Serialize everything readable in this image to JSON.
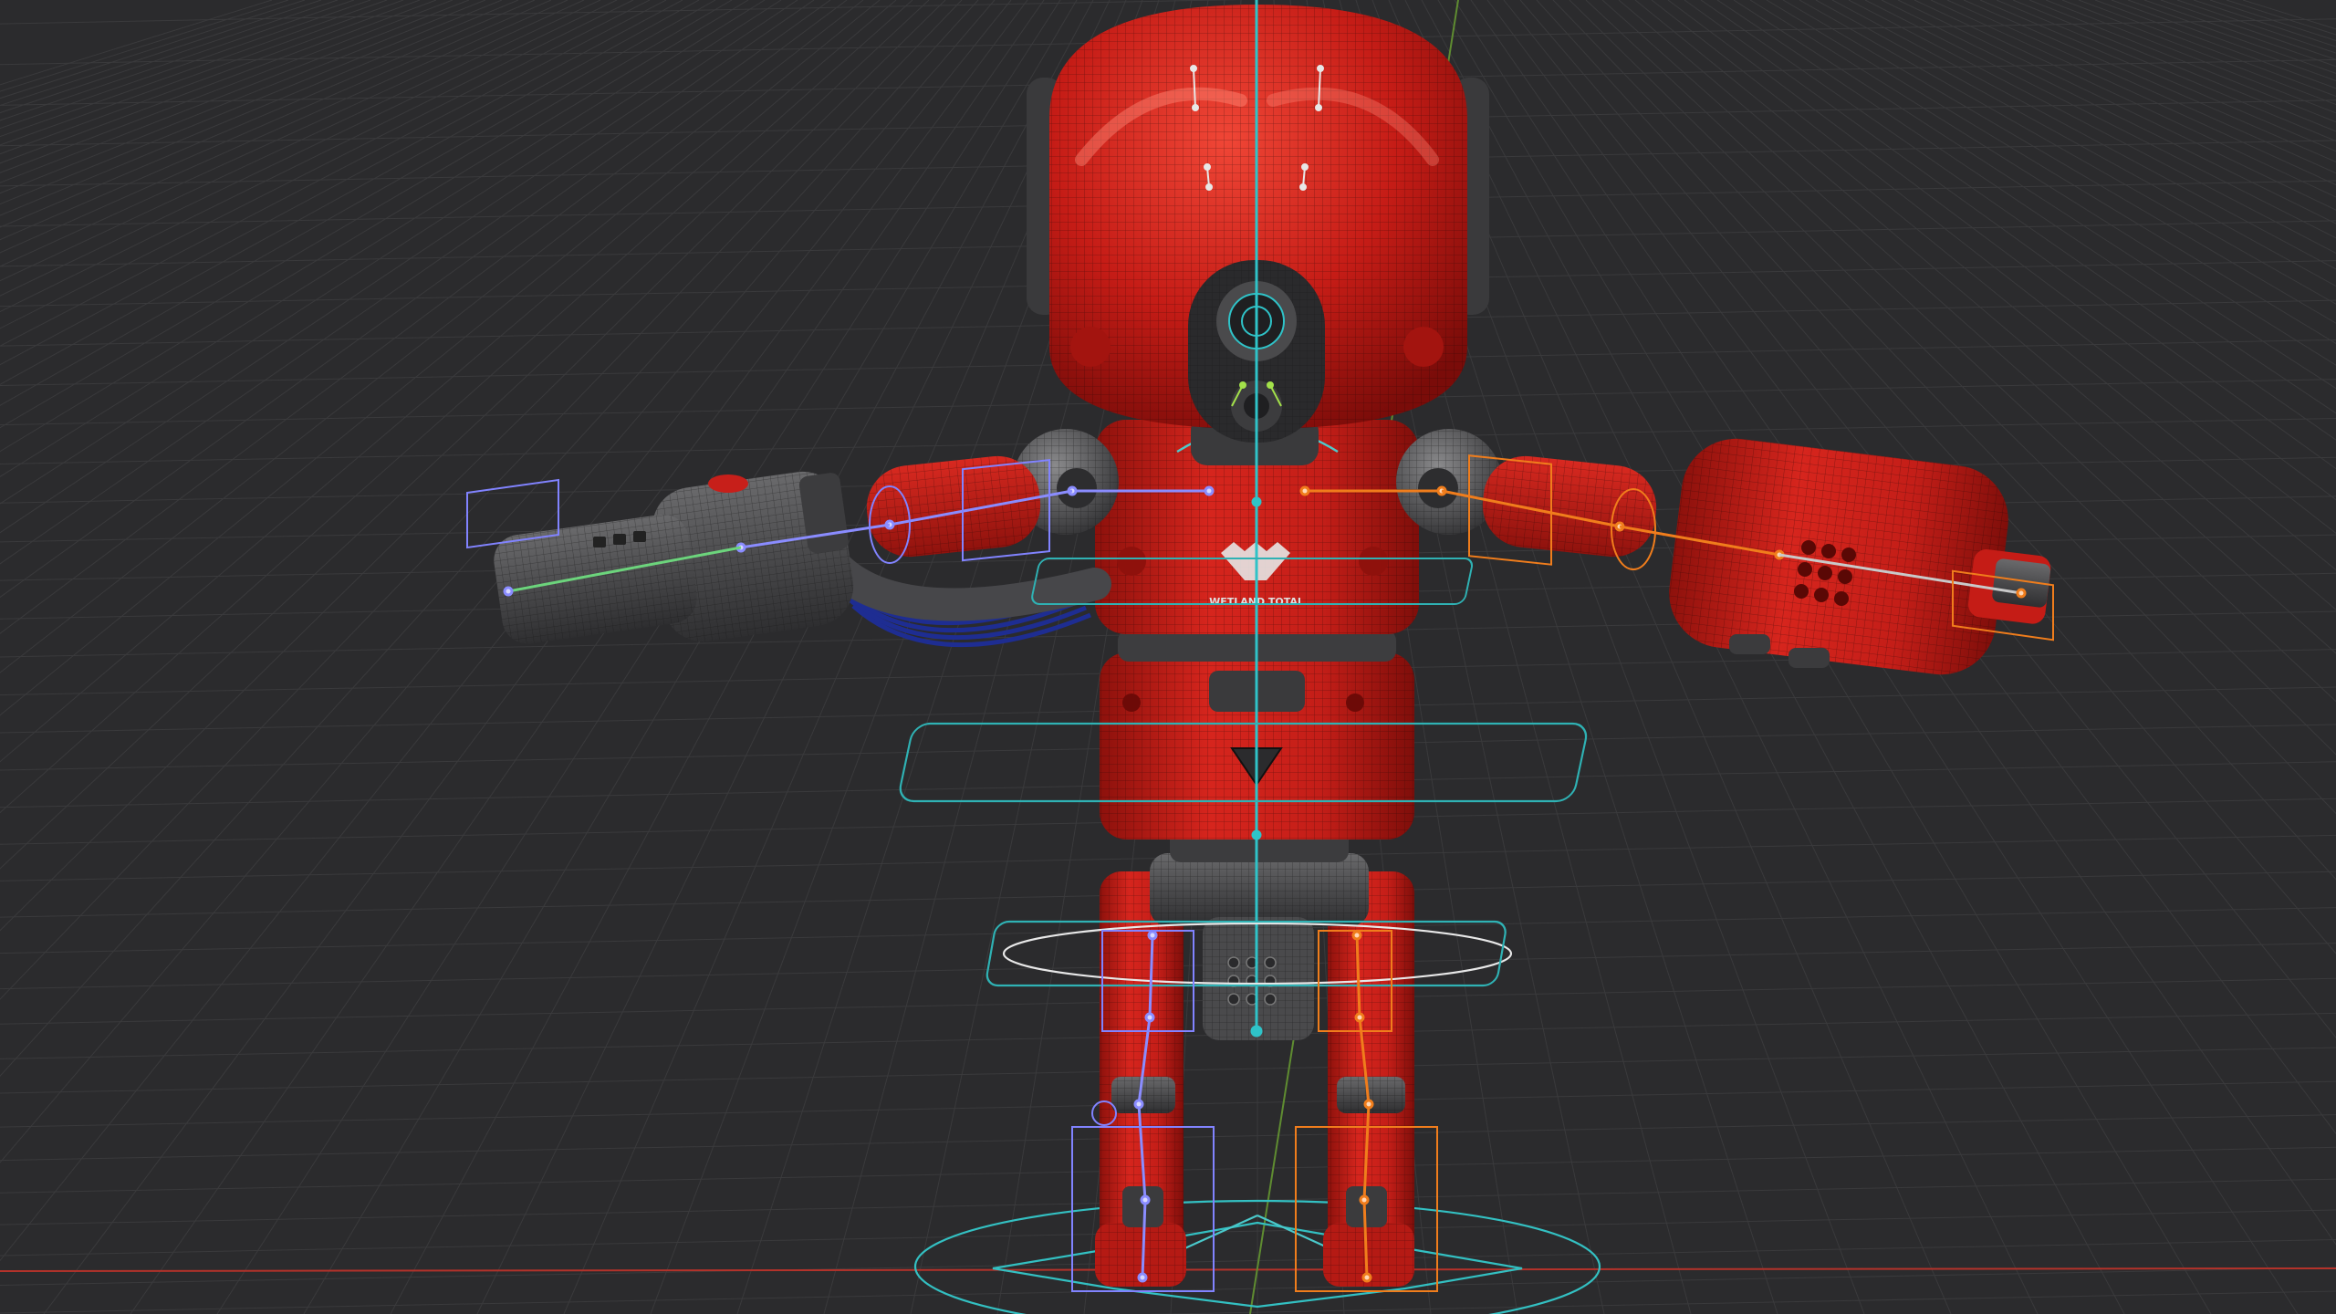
{
  "viewport": {
    "background": "#2b2b2d",
    "grid_color": "#3a3a3c",
    "x_axis_color": "#c0392b",
    "y_axis_color": "#6f9e3a"
  },
  "model": {
    "name": "red-robot",
    "body_color": "#c71f1a",
    "metal_color": "#4a4a4c",
    "wire_color": "#1c2a88",
    "logo_text": "WETLAND TOTAL"
  },
  "rig": {
    "center_bone_color": "#2fc3c8",
    "left_side_color": "#8a8cff",
    "right_side_color": "#f07d1c",
    "control_color": "#31b7b9"
  }
}
